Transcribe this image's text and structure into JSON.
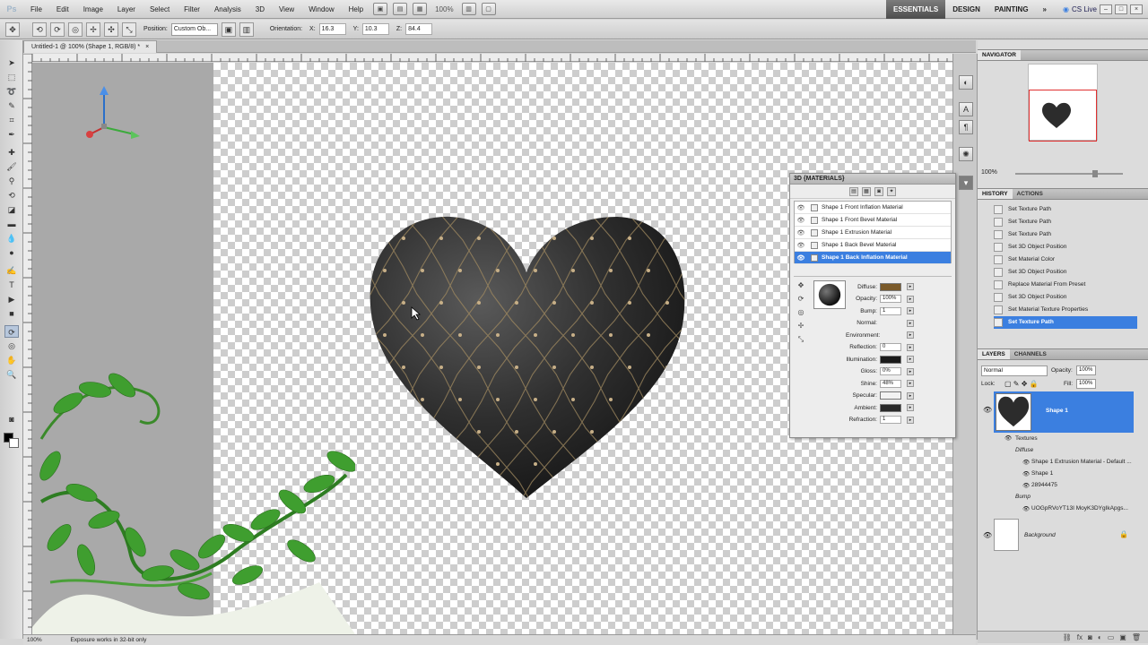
{
  "app": {
    "logo": "Ps"
  },
  "menu": [
    "File",
    "Edit",
    "Image",
    "Layer",
    "Select",
    "Filter",
    "Analysis",
    "3D",
    "View",
    "Window",
    "Help"
  ],
  "menubar": {
    "zoom": "100%",
    "workspaces": [
      "ESSENTIALS",
      "DESIGN",
      "PAINTING"
    ],
    "more": "»",
    "cs_live": "CS Live"
  },
  "options": {
    "position_label": "Position:",
    "position_value": "Custom Ob...",
    "orientation_label": "Orientation:",
    "x_label": "X:",
    "x_value": "16.3",
    "y_label": "Y:",
    "y_value": "10.3",
    "z_label": "Z:",
    "z_value": "84.4"
  },
  "document": {
    "tab_title": "Untitled-1 @ 100% (Shape 1, RGB/8) *",
    "tab_close": "×"
  },
  "materials_panel": {
    "title": "3D {MATERIALS}",
    "materials": [
      "Shape 1 Front Inflation Material",
      "Shape 1 Front Bevel Material",
      "Shape 1 Extrusion Material",
      "Shape 1 Back Bevel Material",
      "Shape 1 Back Inflation Material"
    ],
    "selected_index": 4,
    "props": [
      {
        "label": "Diffuse:",
        "kind": "swatch",
        "color": "#7a5a2a"
      },
      {
        "label": "Opacity:",
        "kind": "value",
        "value": "100%"
      },
      {
        "label": "Bump:",
        "kind": "value",
        "value": "1"
      },
      {
        "label": "Normal:",
        "kind": "none"
      },
      {
        "label": "Environment:",
        "kind": "none"
      },
      {
        "label": "Reflection:",
        "kind": "value",
        "value": "0"
      },
      {
        "label": "Illumination:",
        "kind": "swatch",
        "color": "#1a1a1a"
      },
      {
        "label": "Gloss:",
        "kind": "value",
        "value": "0%"
      },
      {
        "label": "Shine:",
        "kind": "value",
        "value": "48%"
      },
      {
        "label": "Specular:",
        "kind": "swatch",
        "color": "#f2f2f2"
      },
      {
        "label": "Ambient:",
        "kind": "swatch",
        "color": "#2a2a2a"
      },
      {
        "label": "Refraction:",
        "kind": "value",
        "value": "1"
      }
    ]
  },
  "navigator": {
    "tab": "NAVIGATOR",
    "zoom": "100%"
  },
  "history": {
    "tabs": [
      "HISTORY",
      "ACTIONS"
    ],
    "items": [
      "Set Texture Path",
      "Set Texture Path",
      "Set Texture Path",
      "Set 3D Object Position",
      "Set Material Color",
      "Set 3D Object Position",
      "Replace Material From Preset",
      "Set 3D Object Position",
      "Set Material Texture Properties",
      "Set Texture Path"
    ],
    "selected_index": 9
  },
  "layers": {
    "tabs": [
      "LAYERS",
      "CHANNELS"
    ],
    "blend_mode": "Normal",
    "opacity_label": "Opacity:",
    "opacity": "100%",
    "lock_label": "Lock:",
    "fill_label": "Fill:",
    "fill": "100%",
    "shape_layer": "Shape 1",
    "textures_label": "Textures",
    "diffuse_label": "Diffuse",
    "diffuse_items": [
      "Shape 1 Extrusion Material - Default ...",
      "Shape 1",
      "28944475"
    ],
    "bump_label": "Bump",
    "bump_items": [
      "UOGpRVoYT13I MoyK3DYgIkApgs..."
    ],
    "background_layer": "Background"
  },
  "status": {
    "zoom": "100%",
    "message": "Exposure works in 32-bit only"
  }
}
